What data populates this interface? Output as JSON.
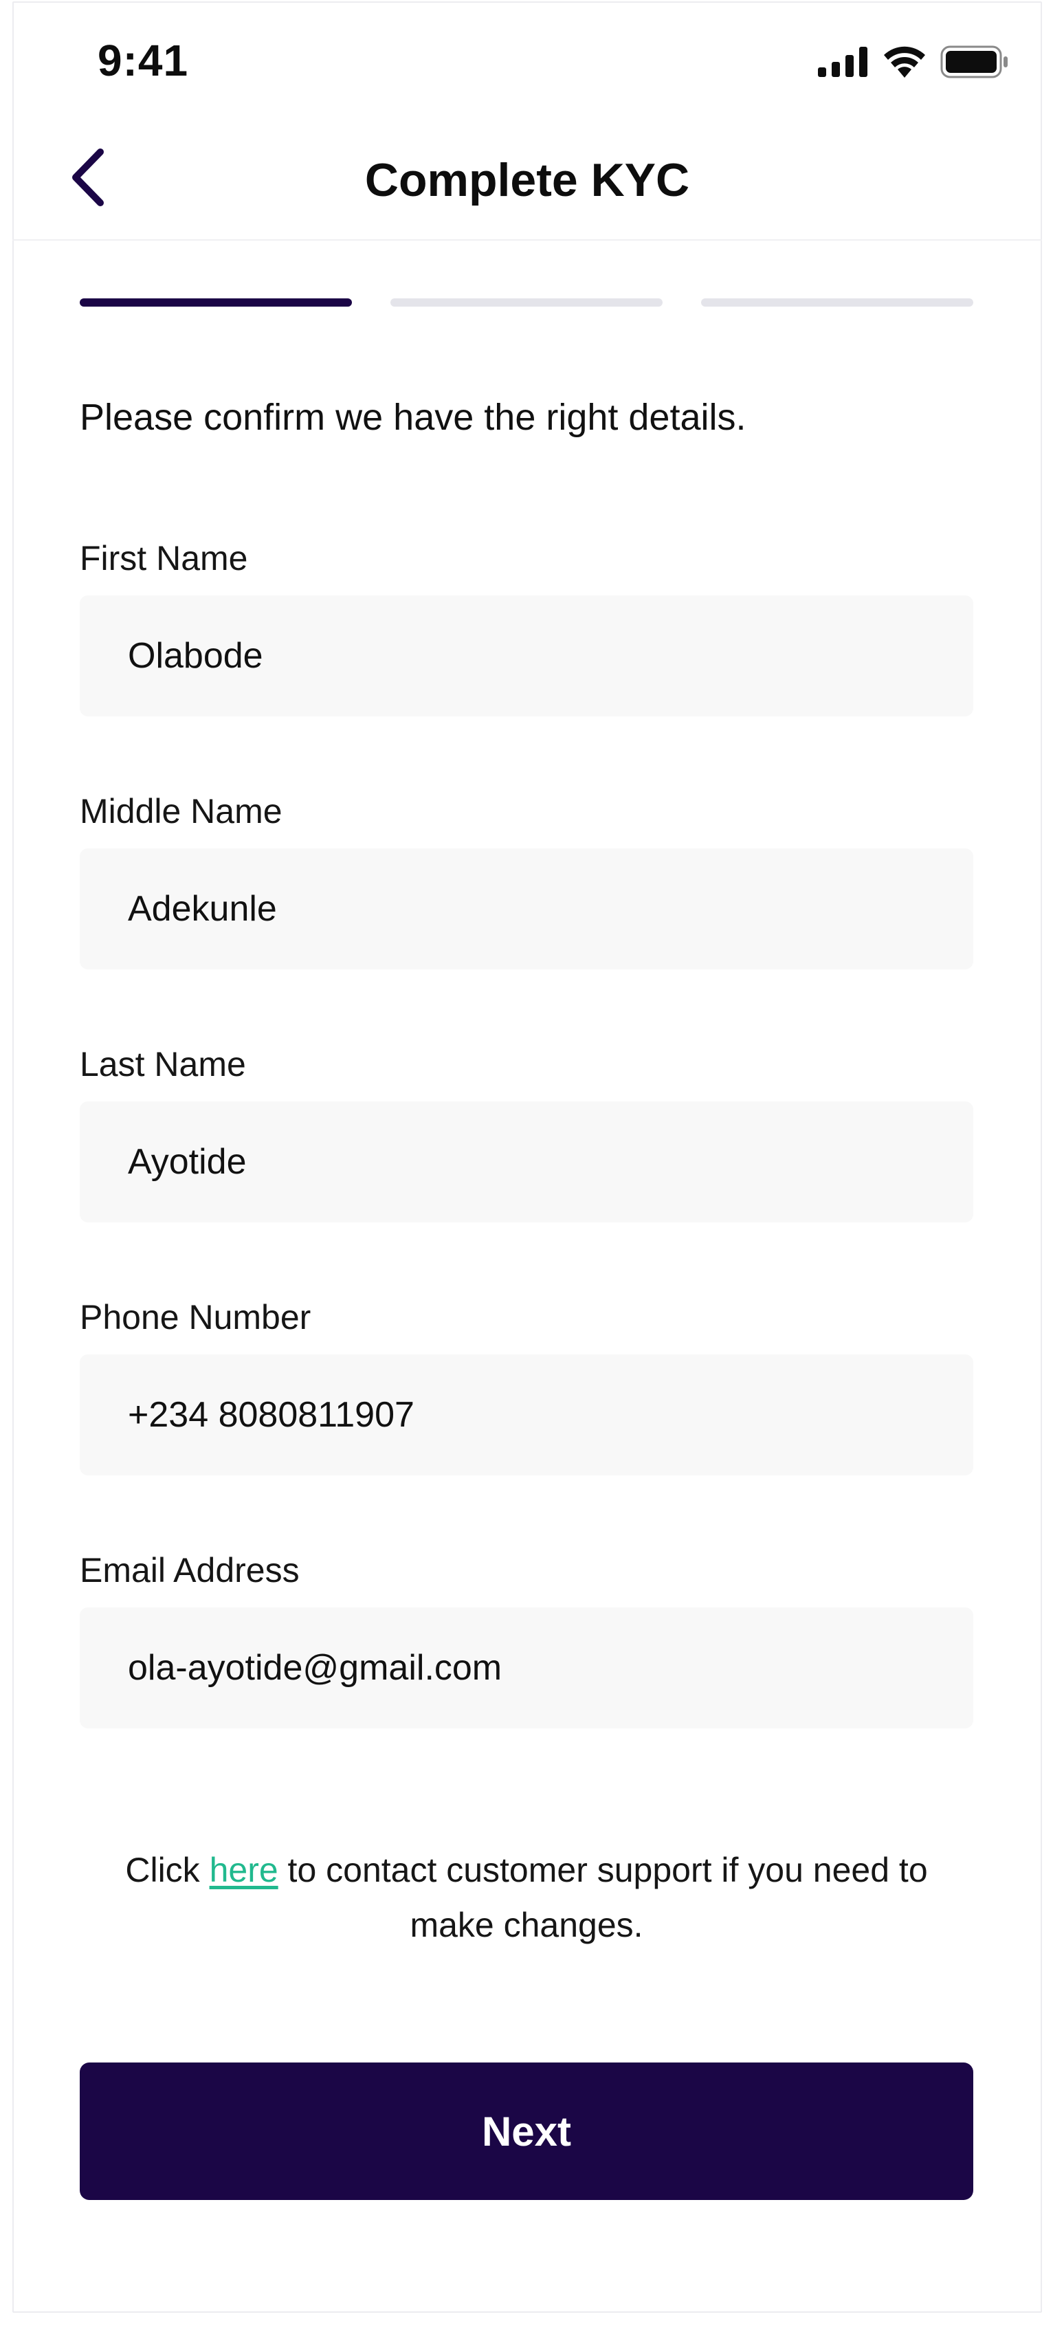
{
  "status_bar": {
    "time": "9:41",
    "icons": [
      "cellular-signal-icon",
      "wifi-icon",
      "battery-icon"
    ]
  },
  "nav": {
    "title": "Complete KYC",
    "back_icon": "chevron-left-icon"
  },
  "progress": {
    "total_steps": 3,
    "current_step": 1
  },
  "intro": "Please confirm we have the right details.",
  "form": {
    "first_name": {
      "label": "First Name",
      "value": "Olabode"
    },
    "middle_name": {
      "label": "Middle Name",
      "value": "Adekunle"
    },
    "last_name": {
      "label": "Last Name",
      "value": "Ayotide"
    },
    "phone": {
      "label": "Phone Number",
      "value": "+234 8080811907"
    },
    "email": {
      "label": "Email Address",
      "value": "ola-ayotide@gmail.com"
    }
  },
  "support": {
    "prefix": "Click ",
    "link": "here",
    "suffix": " to contact customer support if you need to make changes."
  },
  "next_button": "Next",
  "colors": {
    "primary": "#1b0646",
    "link": "#21b98e",
    "input_background": "#f8f8f8",
    "inactive_step": "#e4e4ea"
  }
}
